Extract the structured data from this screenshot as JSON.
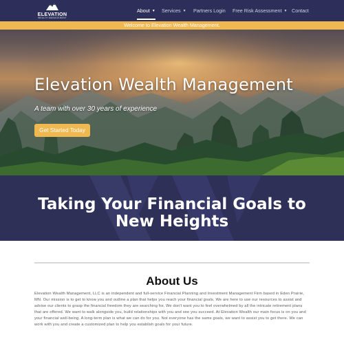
{
  "brand": {
    "name": "ELEVATION",
    "tagline": "WEALTH MANAGEMENT"
  },
  "nav": {
    "items": [
      {
        "label": "About",
        "has_dropdown": true,
        "active": true
      },
      {
        "label": "Services",
        "has_dropdown": true,
        "active": false
      },
      {
        "label": "Partners Login",
        "has_dropdown": false,
        "active": false
      },
      {
        "label": "Free Risk Assessment",
        "has_dropdown": true,
        "active": false
      },
      {
        "label": "Contact",
        "has_dropdown": false,
        "active": false
      }
    ]
  },
  "welcome_bar": {
    "text": "Welcome to Elevation Wealth Management."
  },
  "hero": {
    "title": "Elevation Wealth Management",
    "subtitle": "A team with over 30 years of experience",
    "cta_label": "Get Started Today"
  },
  "band": {
    "title_line1": "Taking Your Financial Goals to",
    "title_line2": "New Heights"
  },
  "about": {
    "title": "About Us",
    "body": "Elevation Wealth Management, LLC is an independent and full-service Financial Planning and Investment Management Firm based in Eden Prairie, MN. Our mission is to get to know you and outline a plan that helps you reach your financial goals. We are here to use our resources to assist and advise our clients to grasp the financial freedom they are searching for. We don't want you to feel overwhelmed by all the intricate retirement plans that are offered. We want to walk alongside you, build relationships with you and see you succeed. At Elevation Wealth our main focus is on you and your financial well-being. A long-term plan is what we can do for you. Not everyone has the same goals, we want to assist you to get there. We can work with you and create a customized plan to help you establish goals for your future."
  },
  "colors": {
    "nav_bg": "#2d2f5a",
    "accent_gold": "#efb850",
    "band_bg": "#2e3058"
  },
  "icons": {
    "logo_mark": "mountain-peaks-icon",
    "dropdown": "chevron-down-icon"
  }
}
